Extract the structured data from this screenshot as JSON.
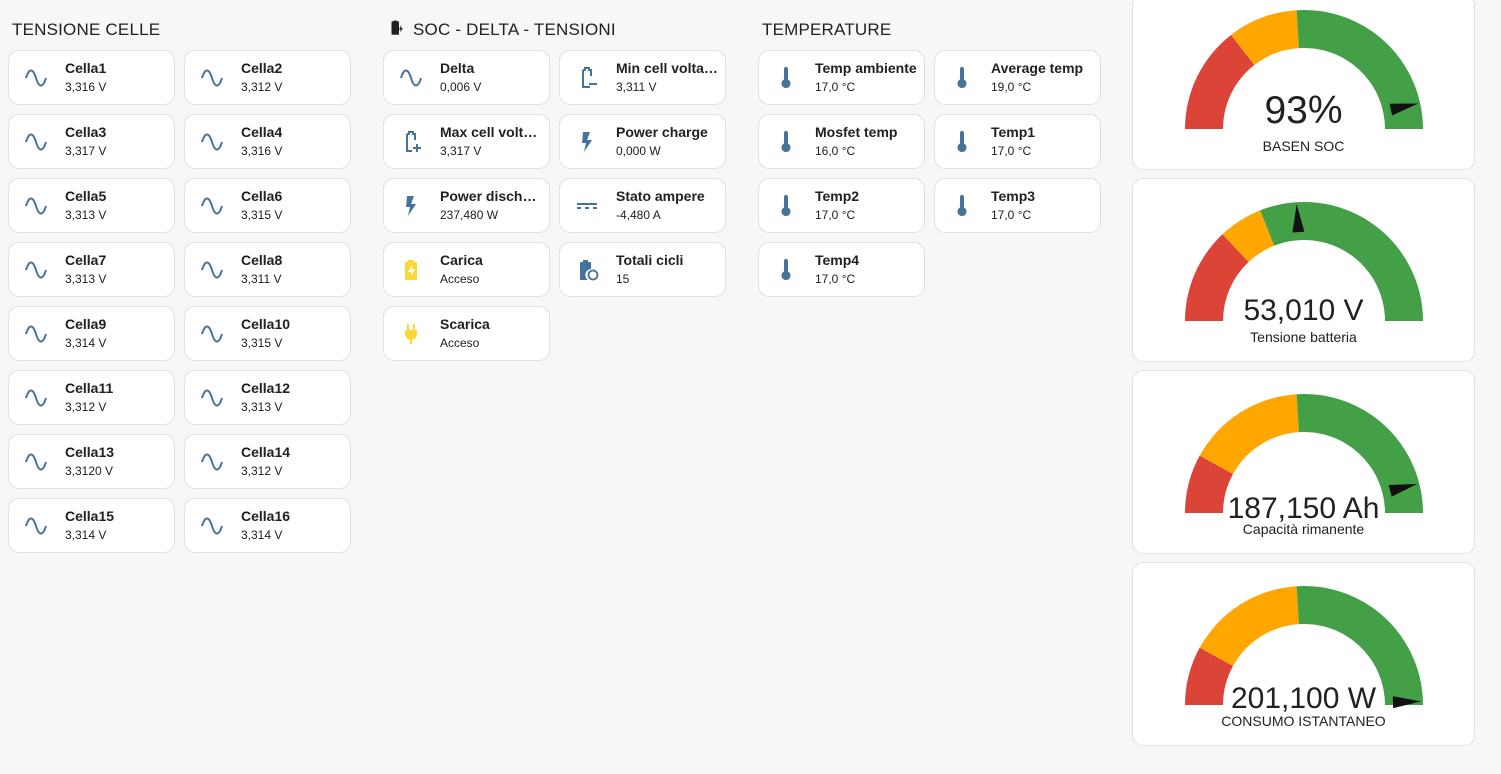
{
  "sections": {
    "cells_title": "TENSIONE CELLE",
    "soc_title": "SOC - DELTA - TENSIONI",
    "temp_title": "TEMPERATURE"
  },
  "cells": [
    {
      "name": "Cella1",
      "state": "3,316 V",
      "icon": "sine-wave-icon"
    },
    {
      "name": "Cella2",
      "state": "3,312 V",
      "icon": "sine-wave-icon"
    },
    {
      "name": "Cella3",
      "state": "3,317 V",
      "icon": "sine-wave-icon"
    },
    {
      "name": "Cella4",
      "state": "3,316 V",
      "icon": "sine-wave-icon"
    },
    {
      "name": "Cella5",
      "state": "3,313 V",
      "icon": "sine-wave-icon"
    },
    {
      "name": "Cella6",
      "state": "3,315 V",
      "icon": "sine-wave-icon"
    },
    {
      "name": "Cella7",
      "state": "3,313 V",
      "icon": "sine-wave-icon"
    },
    {
      "name": "Cella8",
      "state": "3,311 V",
      "icon": "sine-wave-icon"
    },
    {
      "name": "Cella9",
      "state": "3,314 V",
      "icon": "sine-wave-icon"
    },
    {
      "name": "Cella10",
      "state": "3,315 V",
      "icon": "sine-wave-icon"
    },
    {
      "name": "Cella11",
      "state": "3,312 V",
      "icon": "sine-wave-icon"
    },
    {
      "name": "Cella12",
      "state": "3,313 V",
      "icon": "sine-wave-icon"
    },
    {
      "name": "Cella13",
      "state": "3,3120 V",
      "icon": "sine-wave-icon"
    },
    {
      "name": "Cella14",
      "state": "3,312 V",
      "icon": "sine-wave-icon"
    },
    {
      "name": "Cella15",
      "state": "3,314 V",
      "icon": "sine-wave-icon"
    },
    {
      "name": "Cella16",
      "state": "3,314 V",
      "icon": "sine-wave-icon"
    }
  ],
  "soc": [
    {
      "name": "Delta",
      "state": "0,006 V",
      "icon": "sine-wave-icon"
    },
    {
      "name": "Min cell voltage",
      "state": "3,311 V",
      "icon": "battery-minus-icon"
    },
    {
      "name": "Max cell voltage",
      "state": "3,317 V",
      "icon": "battery-plus-icon"
    },
    {
      "name": "Power charge",
      "state": "0,000 W",
      "icon": "flash-icon"
    },
    {
      "name": "Power discharge",
      "state": "237,480 W",
      "icon": "flash-icon"
    },
    {
      "name": "Stato ampere",
      "state": "-4,480 A",
      "icon": "current-dc-icon"
    },
    {
      "name": "Carica",
      "state": "Acceso",
      "icon": "battery-charging-icon"
    },
    {
      "name": "Totali cicli",
      "state": "15",
      "icon": "battery-sync-icon"
    },
    {
      "name": "Scarica",
      "state": "Acceso",
      "icon": "power-plug-icon"
    }
  ],
  "temps": [
    {
      "name": "Temp ambiente",
      "state": "17,0 °C",
      "icon": "thermometer-icon"
    },
    {
      "name": "Average temp",
      "state": "19,0 °C",
      "icon": "thermometer-icon"
    },
    {
      "name": "Mosfet temp",
      "state": "16,0 °C",
      "icon": "thermometer-icon"
    },
    {
      "name": "Temp1",
      "state": "17,0 °C",
      "icon": "thermometer-icon"
    },
    {
      "name": "Temp2",
      "state": "17,0 °C",
      "icon": "thermometer-icon"
    },
    {
      "name": "Temp3",
      "state": "17,0 °C",
      "icon": "thermometer-icon"
    },
    {
      "name": "Temp4",
      "state": "17,0 °C",
      "icon": "thermometer-icon"
    }
  ],
  "gauges": [
    {
      "value_text": "93%",
      "label": "BASEN SOC",
      "fraction": 0.93,
      "segments": [
        0.29,
        0.48,
        1.0
      ]
    },
    {
      "value_text": "53,010 V",
      "label": "Tensione batteria",
      "fraction": 0.48,
      "segments": [
        0.26,
        0.38,
        1.0
      ]
    },
    {
      "value_text": "187,150 Ah",
      "label": "Capacità rimanente",
      "fraction": 0.92,
      "segments": [
        0.16,
        0.48,
        1.0
      ]
    },
    {
      "value_text": "201,100 W",
      "label": "CONSUMO ISTANTANEO",
      "fraction": 0.99,
      "segments": [
        0.16,
        0.48,
        1.0
      ]
    }
  ],
  "colors": {
    "icon_blue": "#44739e",
    "icon_yellow": "#fdd835",
    "gauge_red": "#db4437",
    "gauge_orange": "#ffa600",
    "gauge_green": "#43a047",
    "needle": "#111111"
  }
}
